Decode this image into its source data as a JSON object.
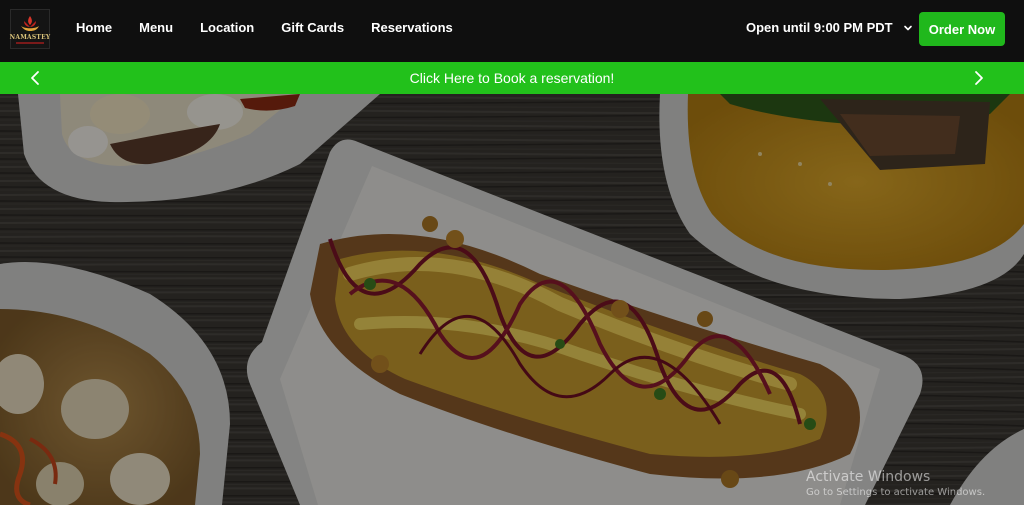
{
  "brand": {
    "logo_text": "NAMASTEY"
  },
  "nav": {
    "items": [
      {
        "label": "Home"
      },
      {
        "label": "Menu"
      },
      {
        "label": "Location"
      },
      {
        "label": "Gift Cards"
      },
      {
        "label": "Reservations"
      }
    ]
  },
  "header": {
    "hours_label": "Open until 9:00 PM PDT",
    "order_button_label": "Order Now"
  },
  "banner": {
    "text": "Click Here to Book a reservation!"
  },
  "watermark": {
    "title": "Activate Windows",
    "subtitle": "Go to Settings to activate Windows."
  },
  "colors": {
    "header_bg": "#0f0f0f",
    "accent_green": "#22c11b",
    "button_green": "#20b81c",
    "text_white": "#ffffff"
  },
  "icons": {
    "hours_toggle": "chevron-down-icon",
    "banner_prev": "chevron-left-icon",
    "banner_next": "chevron-right-icon",
    "logo": "flame-lotus-icon"
  }
}
